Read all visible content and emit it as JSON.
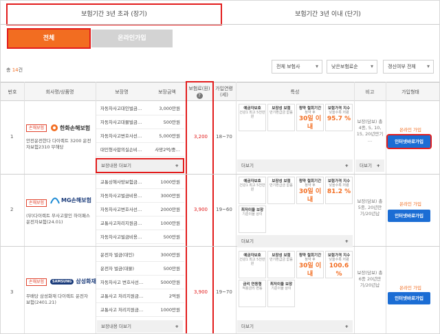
{
  "tabs": {
    "long": "보험기간 3년 초과 (장기)",
    "short": "보험기간 3년 이내 (단기)"
  },
  "subtabs": {
    "all": "전체",
    "online": "온라인가입"
  },
  "count": {
    "prefix": "총",
    "num": "14",
    "suffix": "건"
  },
  "filters": {
    "insurer": "전체 보험사",
    "sort": "낮은보험료순",
    "renew": "갱신여부 전체"
  },
  "headers": {
    "no": "번호",
    "company": "회사명/상품명",
    "coverage": "보장명",
    "amount": "보장금액",
    "premium": "보험료(원)",
    "age": "가입연령(세)",
    "features": "특성",
    "note": "비고",
    "join": "가입형태"
  },
  "rows": [
    {
      "no": "1",
      "badge": "손해보험",
      "company": "한화손해보험",
      "product": "안전운전한다 다이렉트 3200 운전자보험2310 무해당",
      "coverages": [
        {
          "name": "자동차사고대인벌금…",
          "amount": "3,000만원"
        },
        {
          "name": "자동차사고대물벌금…",
          "amount": "500만원"
        },
        {
          "name": "자동차사고변호사선…",
          "amount": "5,000만원"
        },
        {
          "name": "대인형사합의실손비…",
          "amount": "사망2억/중…"
        }
      ],
      "more": "보장내용 더보기",
      "premium": "3,200",
      "age": "18~70",
      "features": [
        {
          "t": "예금자보호",
          "s": "건강1 최고 5천만원",
          "v": ""
        },
        {
          "t": "보장성 보험",
          "s": "만기환급금 없음",
          "v": ""
        },
        {
          "t": "청약 철회기간",
          "s": "청약 후",
          "v": "30일 이내"
        },
        {
          "t": "보험가격 지수",
          "s": "낮을수록 저렴",
          "v": "95.7 %"
        }
      ],
      "feat_more": "더보기",
      "note": "보장(담보) 총 4종, 5, 10, 15, 20년만기 …",
      "note_more": "더보기",
      "join_type": "온라인 가입",
      "button": "인터넷바로가입"
    },
    {
      "no": "2",
      "badge": "손해보험",
      "company": "MG손해보험",
      "product": "(무)다이렉트 무사고할인 하이패스 운전자보험(24.01)",
      "coverages": [
        {
          "name": "교통상해사망보험금…",
          "amount": "1000만원"
        },
        {
          "name": "자동차사고벌금비용…",
          "amount": "3000만원"
        },
        {
          "name": "자동차사고변호사선…",
          "amount": "2000만원"
        },
        {
          "name": "교통사고처리지원금…",
          "amount": "1000만원"
        },
        {
          "name": "자동차사고벌금비용…",
          "amount": "500만원"
        }
      ],
      "premium": "3,900",
      "age": "19~60",
      "features": [
        {
          "t": "예금자보호",
          "s": "건강1 최고 5천만원",
          "v": ""
        },
        {
          "t": "보장성 보험",
          "s": "만기환급금 없음",
          "v": ""
        },
        {
          "t": "청약 철회기간",
          "s": "청약 후",
          "v": "30일 이내"
        },
        {
          "t": "보험가격 지수",
          "s": "낮을수록 저렴",
          "v": "81.2 %"
        },
        {
          "t": "최저이율 보장",
          "s": "기준이율 상이",
          "v": ""
        }
      ],
      "feat_more": "더보기",
      "note": "보장(담보) 총 5종, 20년만기/20년납",
      "join_type": "온라인 가입",
      "button": "인터넷바로가입"
    },
    {
      "no": "3",
      "badge": "손해보험",
      "company": "삼성화재",
      "product": "무배당 삼성화재 다이렉트 운전자보험(2401.21)",
      "coverages": [
        {
          "name": "운전자 벌금(대인)",
          "amount": "3000만원"
        },
        {
          "name": "운전자 벌금(대물)",
          "amount": "500만원"
        },
        {
          "name": "자동차사고 변호사선…",
          "amount": "5000만원"
        },
        {
          "name": "교통사고 처리지원금…",
          "amount": "2억원"
        },
        {
          "name": "교통사고 처리지원금…",
          "amount": "1000만원"
        }
      ],
      "more": "보장내용 더보기",
      "premium": "3,900",
      "age": "19~70",
      "features": [
        {
          "t": "예금자보호",
          "s": "건강1 최고 5천만원",
          "v": ""
        },
        {
          "t": "보장성 보험",
          "s": "만기환급금 없음",
          "v": ""
        },
        {
          "t": "청약 철회기간",
          "s": "청약 후",
          "v": "30일 이내"
        },
        {
          "t": "보험가격 지수",
          "s": "낮을수록 저렴",
          "v": "100.6 %"
        },
        {
          "t": "금리 연동형",
          "s": "적용금리 변동",
          "v": ""
        },
        {
          "t": "최저이율 보장",
          "s": "기준이율 상이",
          "v": ""
        }
      ],
      "feat_more": "더보기",
      "note": "보장(담보) 총 6종 20년만기/20년납",
      "join_type": "온라인 가입",
      "button": "인터넷바로가입"
    }
  ],
  "colors": {
    "orange": "#f26d21",
    "red": "#e21b1b",
    "blue": "#1b6dd4"
  }
}
